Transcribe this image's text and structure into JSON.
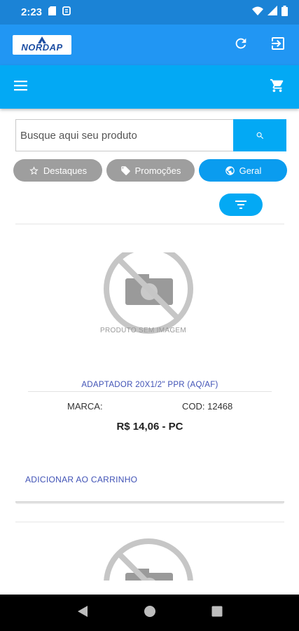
{
  "status_bar": {
    "time": "2:23"
  },
  "app_bar": {
    "logo_text": "NORDAP"
  },
  "search": {
    "placeholder": "Busque aqui seu produto"
  },
  "filter_chips": [
    {
      "label": "Destaques",
      "icon": "star-outline-icon"
    },
    {
      "label": "Promoções",
      "icon": "tag-icon"
    },
    {
      "label": "Geral",
      "icon": "globe-icon"
    }
  ],
  "products": [
    {
      "image_caption": "PRODUTO SEM IMAGEM",
      "name": "ADAPTADOR 20X1/2\" PPR (AQ/AF)",
      "brand_label": "MARCA:",
      "code_label": "COD: 12468",
      "price": "R$ 14,06 - PC",
      "add_to_cart": "ADICIONAR AO CARRINHO"
    }
  ],
  "colors": {
    "status_bar": "#1b83d6",
    "app_bar": "#2196f3",
    "toolbar": "#03a9f4",
    "chip_inactive": "#9e9e9e",
    "chip_active": "#0a9cef",
    "link": "#3f51b5"
  }
}
